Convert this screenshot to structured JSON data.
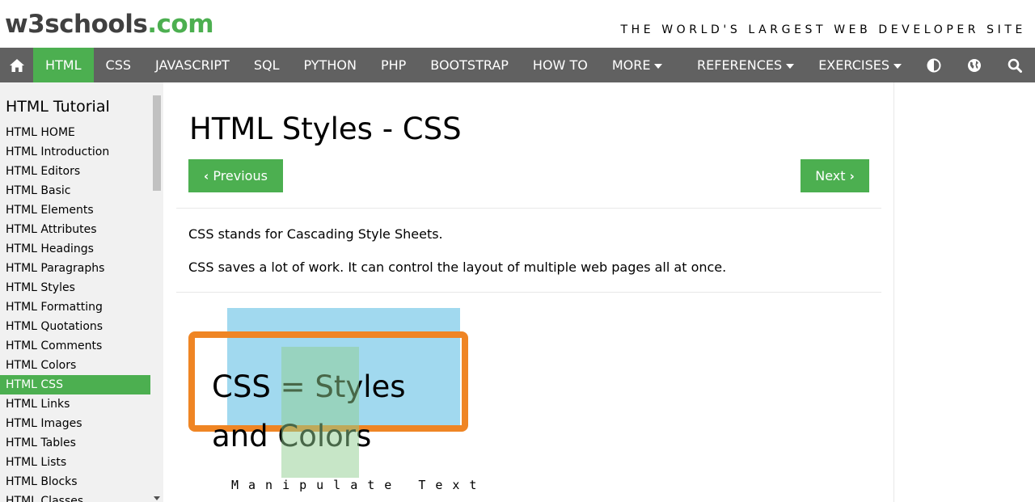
{
  "header": {
    "logo_main": "w3schools",
    "logo_tld": ".com",
    "tagline": "THE WORLD'S LARGEST WEB DEVELOPER SITE"
  },
  "topnav": {
    "items": [
      {
        "label": "HTML",
        "active": true
      },
      {
        "label": "CSS"
      },
      {
        "label": "JAVASCRIPT"
      },
      {
        "label": "SQL"
      },
      {
        "label": "PYTHON"
      },
      {
        "label": "PHP"
      },
      {
        "label": "BOOTSTRAP"
      },
      {
        "label": "HOW TO"
      },
      {
        "label": "MORE"
      }
    ],
    "right_items": [
      {
        "label": "REFERENCES"
      },
      {
        "label": "EXERCISES"
      }
    ],
    "icons": [
      "home-icon",
      "contrast-icon",
      "globe-icon",
      "search-icon"
    ]
  },
  "sidebar": {
    "title": "HTML Tutorial",
    "items": [
      "HTML HOME",
      "HTML Introduction",
      "HTML Editors",
      "HTML Basic",
      "HTML Elements",
      "HTML Attributes",
      "HTML Headings",
      "HTML Paragraphs",
      "HTML Styles",
      "HTML Formatting",
      "HTML Quotations",
      "HTML Comments",
      "HTML Colors",
      "HTML CSS",
      "HTML Links",
      "HTML Images",
      "HTML Tables",
      "HTML Lists",
      "HTML Blocks",
      "HTML Classes"
    ],
    "active_item": "HTML CSS"
  },
  "main": {
    "title": "HTML Styles - CSS",
    "prev_label": "Previous",
    "next_label": "Next",
    "para1": "CSS stands for Cascading Style Sheets.",
    "para2": "CSS saves a lot of work. It can control the layout of multiple web pages all at once.",
    "illustration": {
      "line1": "CSS = Styles",
      "line2": "and Colors",
      "line3": "Manipulate Text"
    }
  },
  "colors": {
    "accent": "#4caf50",
    "nav_bg": "#616161",
    "sidebar_bg": "#f1f1f1",
    "orange": "#ef8524",
    "sky_blue": "#87ceeb"
  }
}
